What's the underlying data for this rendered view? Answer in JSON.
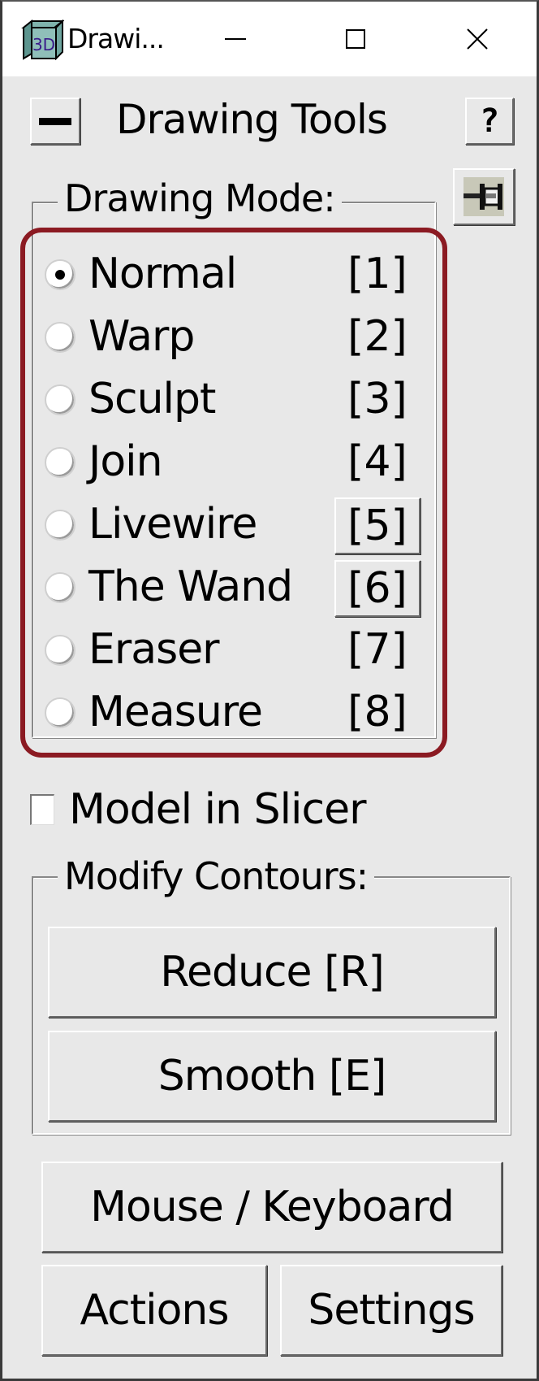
{
  "window": {
    "title": "Drawi...",
    "app_icon": "3d-cube-icon",
    "app_icon_text": "3D",
    "controls": {
      "minimize_icon": "minimize-icon",
      "maximize_icon": "maximize-icon",
      "close_icon": "close-icon"
    }
  },
  "header": {
    "collapse_icon": "minus-icon",
    "title": "Drawing Tools",
    "help_label": "?",
    "pin_icon": "pushpin-icon"
  },
  "drawing_mode": {
    "legend": "Drawing Mode:",
    "highlight_color": "#8b1a22",
    "selected": "Normal",
    "items": [
      {
        "label": "Normal",
        "key": "[1]",
        "checked": true,
        "key_button": false
      },
      {
        "label": "Warp",
        "key": "[2]",
        "checked": false,
        "key_button": false
      },
      {
        "label": "Sculpt",
        "key": "[3]",
        "checked": false,
        "key_button": false
      },
      {
        "label": "Join",
        "key": "[4]",
        "checked": false,
        "key_button": false
      },
      {
        "label": "Livewire",
        "key": "[5]",
        "checked": false,
        "key_button": true
      },
      {
        "label": "The Wand",
        "key": "[6]",
        "checked": false,
        "key_button": true
      },
      {
        "label": "Eraser",
        "key": "[7]",
        "checked": false,
        "key_button": false
      },
      {
        "label": "Measure",
        "key": "[8]",
        "checked": false,
        "key_button": false
      }
    ]
  },
  "model_in_slicer": {
    "label": "Model in Slicer",
    "checked": false
  },
  "modify_contours": {
    "legend": "Modify Contours:",
    "reduce_label": "Reduce [R]",
    "smooth_label": "Smooth [E]"
  },
  "footer": {
    "mouse_keyboard_label": "Mouse / Keyboard",
    "actions_label": "Actions",
    "settings_label": "Settings"
  }
}
